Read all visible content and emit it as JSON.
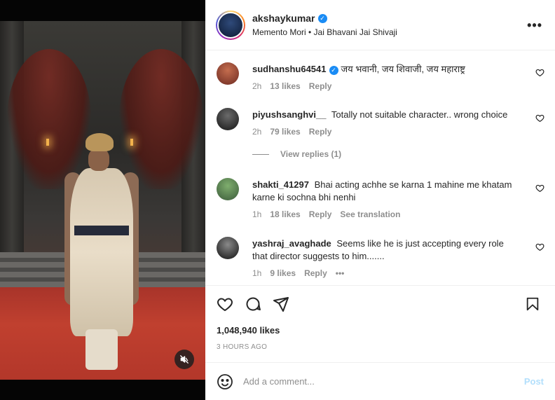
{
  "post": {
    "username": "akshaykumar",
    "subtitle": "Memento Mori • Jai Bhavani Jai Shivaji",
    "more_icon": "more-horizontal-icon"
  },
  "comments": [
    {
      "user": "sudhanshu64541",
      "verified": true,
      "text": "जय भवानी, जय शिवाजी, जय महाराष्ट्र",
      "time": "2h",
      "likes": "13 likes",
      "reply": "Reply"
    },
    {
      "user": "piyushsanghvi__",
      "verified": false,
      "text": "Totally not suitable character.. wrong choice",
      "time": "2h",
      "likes": "79 likes",
      "reply": "Reply",
      "view_replies": "View replies (1)"
    },
    {
      "user": "shakti_41297",
      "verified": false,
      "text": "Bhai acting achhe se karna 1 mahine me khatam karne ki sochna bhi nenhi",
      "time": "1h",
      "likes": "18 likes",
      "reply": "Reply",
      "translate": "See translation"
    },
    {
      "user": "yashraj_avaghade",
      "verified": false,
      "text": "Seems like he is just accepting every role that director suggests to him.......",
      "time": "1h",
      "likes": "9 likes",
      "reply": "Reply",
      "more": "•••"
    }
  ],
  "actions": {
    "likes_count": "1,048,940 likes",
    "timestamp": "3 HOURS AGO"
  },
  "add_comment": {
    "placeholder": "Add a comment...",
    "post_label": "Post"
  },
  "colors": {
    "verified": "#1a8cf5",
    "post_disabled": "#b2dffc",
    "muted_text": "#8e8e8e"
  }
}
